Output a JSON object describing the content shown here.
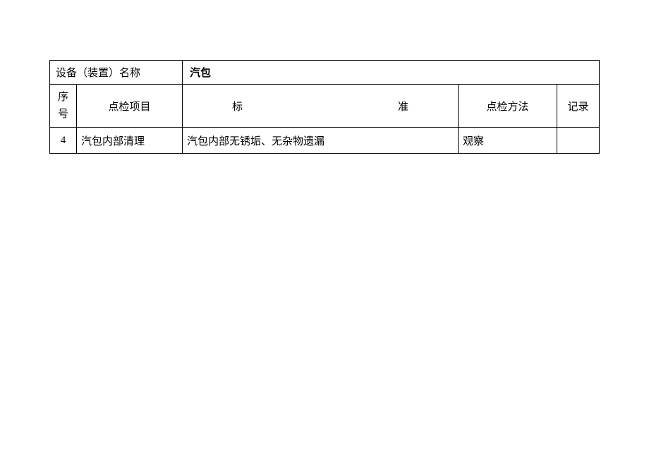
{
  "header": {
    "device_label": "设备（装置）名称",
    "device_name": "汽包"
  },
  "columns": {
    "seq": "序号",
    "item": "点检项目",
    "standard": "标　　　　准",
    "method": "点检方法",
    "record": "记录"
  },
  "rows": [
    {
      "seq": "4",
      "item": "汽包内部清理",
      "standard": "汽包内部无锈垢、无杂物遗漏",
      "method": "观察",
      "record": ""
    }
  ]
}
